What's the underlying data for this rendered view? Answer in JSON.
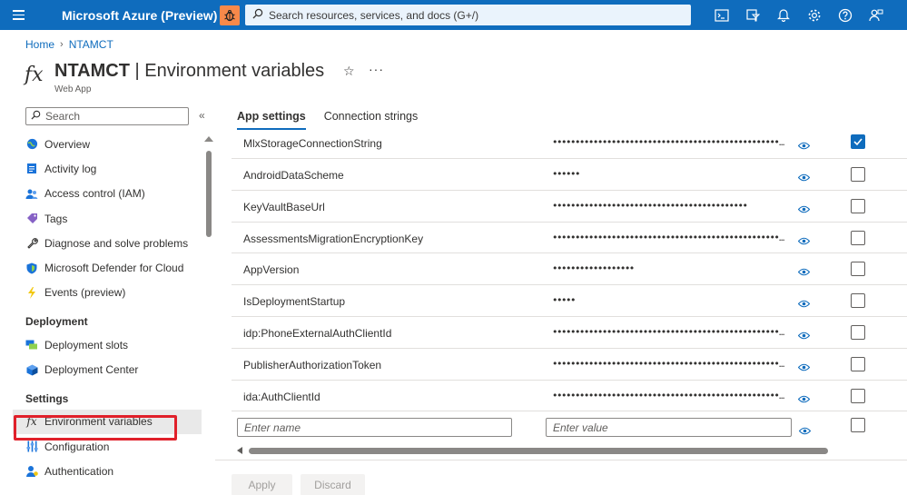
{
  "topbar": {
    "brand": "Microsoft Azure (Preview)",
    "search_placeholder": "Search resources, services, and docs (G+/)",
    "icons": [
      "cloud-shell-icon",
      "directory-filter-icon",
      "bell-icon",
      "gear-icon",
      "help-icon",
      "feedback-icon"
    ]
  },
  "breadcrumb": {
    "home": "Home",
    "resource": "NTAMCT"
  },
  "header": {
    "resource_name": "NTAMCT",
    "separator": " | ",
    "page_title": "Environment variables",
    "subtitle": "Web App"
  },
  "nav": {
    "search_placeholder": "Search",
    "items": [
      {
        "label": "Overview",
        "icon": "globe-icon"
      },
      {
        "label": "Activity log",
        "icon": "activity-log-icon"
      },
      {
        "label": "Access control (IAM)",
        "icon": "people-icon"
      },
      {
        "label": "Tags",
        "icon": "tag-icon"
      },
      {
        "label": "Diagnose and solve problems",
        "icon": "wrench-icon"
      },
      {
        "label": "Microsoft Defender for Cloud",
        "icon": "shield-icon"
      },
      {
        "label": "Events (preview)",
        "icon": "lightning-icon"
      }
    ],
    "group_deployment": "Deployment",
    "deployment_items": [
      {
        "label": "Deployment slots",
        "icon": "slots-icon"
      },
      {
        "label": "Deployment Center",
        "icon": "cube-icon"
      }
    ],
    "group_settings": "Settings",
    "settings_items": [
      {
        "label": "Environment variables",
        "icon": "fx-icon"
      },
      {
        "label": "Configuration",
        "icon": "sliders-icon"
      },
      {
        "label": "Authentication",
        "icon": "user-icon"
      }
    ]
  },
  "tabs": [
    {
      "label": "App settings",
      "active": true
    },
    {
      "label": "Connection strings",
      "active": false
    }
  ],
  "settings": [
    {
      "name": "MlxStorageConnectionString",
      "value": "••••••••••••••••••••••••••••••••••••••••••••••••••...",
      "checked": true
    },
    {
      "name": "AndroidDataScheme",
      "value": "••••••",
      "checked": false
    },
    {
      "name": "KeyVaultBaseUrl",
      "value": "•••••••••••••••••••••••••••••••••••••••••••",
      "checked": false
    },
    {
      "name": "AssessmentsMigrationEncryptionKey",
      "value": "••••••••••••••••••••••••••••••••••••••••••••••••••...",
      "checked": false
    },
    {
      "name": "AppVersion",
      "value": "••••••••••••••••••",
      "checked": false
    },
    {
      "name": "IsDeploymentStartup",
      "value": "•••••",
      "checked": false
    },
    {
      "name": "idp:PhoneExternalAuthClientId",
      "value": "••••••••••••••••••••••••••••••••••••••••••••••••••...",
      "checked": false
    },
    {
      "name": "PublisherAuthorizationToken",
      "value": "••••••••••••••••••••••••••••••••••••••••••••••••••...",
      "checked": false
    },
    {
      "name": "ida:AuthClientId",
      "value": "••••••••••••••••••••••••••••••••••••••••••••••••••...",
      "checked": false
    }
  ],
  "new_row": {
    "name_placeholder": "Enter name",
    "value_placeholder": "Enter value"
  },
  "actions": {
    "apply": "Apply",
    "discard": "Discard"
  },
  "colors": {
    "accent": "#0f6cbd",
    "highlight": "#e0202a"
  }
}
